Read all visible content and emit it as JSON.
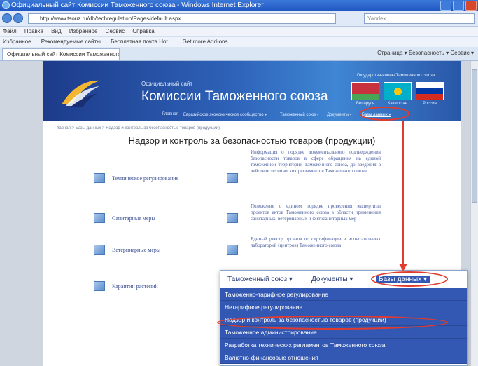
{
  "browser": {
    "window_title": "Официальный сайт Комиссии Таможенного союза - Windows Internet Explorer",
    "url": "http://www.tsouz.ru/db/techregulation/Pages/default.aspx",
    "search_placeholder": "Yandex",
    "menu": [
      "Файл",
      "Правка",
      "Вид",
      "Избранное",
      "Сервис",
      "Справка"
    ],
    "favorites": [
      "Избранное",
      "Рекомендуемые сайты",
      "Бесплатная почта Hot...",
      "Get more Add-ons"
    ],
    "tab_title": "Официальный сайт Комиссии Таможенного...",
    "tools": "Страница ▾  Безопасность ▾  Сервис ▾"
  },
  "site": {
    "kicker": "Официальный сайт",
    "title": "Комиссии Таможенного союза",
    "flags_caption": "Государства-члены Таможенного союза",
    "flags": [
      {
        "code": "by",
        "name": "Беларусь"
      },
      {
        "code": "kz",
        "name": "Казахстан"
      },
      {
        "code": "ru",
        "name": "Россия"
      }
    ],
    "nav": [
      "Главная",
      "Евразийское экономическое сообщество ▾",
      "Таможенный союз ▾",
      "Документы ▾",
      "Базы данных ▾"
    ],
    "breadcrumb": "Главная > Базы данных > Надзор и контроль за безопасностью товаров (продукции)",
    "heading": "Надзор и контроль за безопасностью товаров (продукции)",
    "left_items": [
      "Техническое регулирование",
      "Санитарные меры",
      "Ветеринарные меры",
      "Карантин растений"
    ],
    "right_items": [
      "Информация о порядке документального подтверждения безопасности товаров в сфере обращения на единой таможенной территории Таможенного союза, до введения в действие технических регламентов Таможенного союза",
      "Положение о едином порядке проведения экспертизы проектов актов Таможенного союза в области применения санитарных, ветеринарных и фитосанитарных мер",
      "Единый реестр органов по сертификации и испытательных лабораторий (центров) Таможенного союза"
    ]
  },
  "zoom": {
    "nav": [
      "Таможенный союз ▾",
      "Документы ▾",
      "Базы данных ▾"
    ],
    "items": [
      "Таможенно-тарифное регулирование",
      "Нетарифное регулирование",
      "Надзор и контроль за безопасностью товаров (продукции)",
      "Таможенное администрирование",
      "Разработка технических регламентов Таможенного союза",
      "Валютно-финансовые отношения"
    ]
  },
  "colors": {
    "annotation": "#e23b2e",
    "header_blue": "#2d62b8",
    "menu_blue": "#3258b3"
  }
}
